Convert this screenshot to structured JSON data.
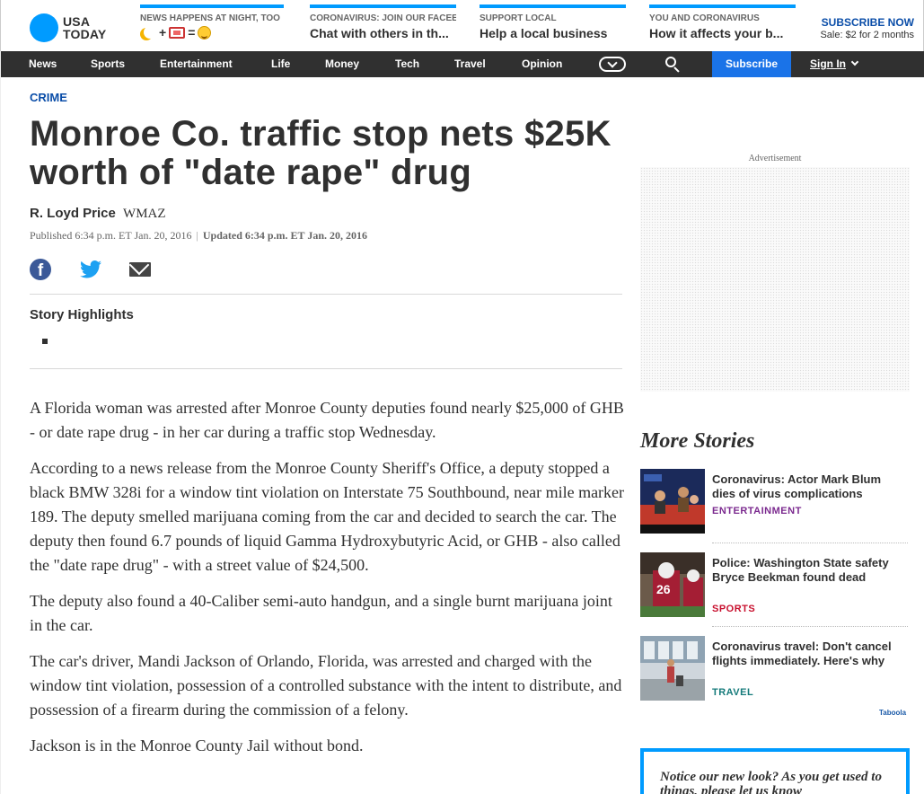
{
  "brand": {
    "line1": "USA",
    "line2": "TODAY"
  },
  "promos": [
    {
      "kicker": "NEWS HAPPENS AT NIGHT, TOO",
      "title": "= "
    },
    {
      "kicker": "CORONAVIRUS: JOIN OUR FACEE",
      "title": "Chat with others in th..."
    },
    {
      "kicker": "SUPPORT LOCAL",
      "title": "Help a local business"
    },
    {
      "kicker": "YOU AND CORONAVIRUS",
      "title": "How it affects your b..."
    }
  ],
  "subscribe_cta": {
    "title": "SUBSCRIBE NOW",
    "subtitle": "Sale: $2 for 2 months"
  },
  "nav": {
    "items": [
      "News",
      "Sports",
      "Entertainment",
      "Life",
      "Money",
      "Tech",
      "Travel",
      "Opinion"
    ],
    "subscribe": "Subscribe",
    "signin": "Sign In"
  },
  "article": {
    "section": "CRIME",
    "headline": "Monroe Co. traffic stop nets $25K worth of \"date rape\" drug",
    "author": "R. Loyd Price",
    "source": "WMAZ",
    "published": "Published 6:34 p.m. ET Jan. 20, 2016",
    "separator": "|",
    "updated": "Updated 6:34 p.m. ET Jan. 20, 2016",
    "highlights_title": "Story Highlights",
    "paragraphs": [
      "A Florida woman was arrested after Monroe County deputies found nearly $25,000 of GHB - or date rape drug - in her car during a traffic stop Wednesday.",
      "According to a news release from the Monroe County Sheriff's Office, a deputy stopped a black BMW 328i for a window tint violation on Interstate 75 Southbound, near mile marker 189. The deputy smelled marijuana coming from the car and decided to search the car. The deputy then found 6.7 pounds of liquid Gamma Hydroxybutyric Acid, or GHB - also called the \"date rape drug\" - with a street value of $24,500.",
      "The deputy also found a 40-Caliber semi-auto handgun, and a single burnt marijuana joint in the car.",
      "The car's driver, Mandi Jackson of Orlando, Florida, was arrested and charged with the window tint violation, possession of a controlled substance with the intent to distribute, and possession of a firearm during the commission of a felony.",
      "Jackson is in the Monroe County Jail without bond."
    ]
  },
  "sidebar": {
    "ad_label": "Advertisement",
    "more_stories_title": "More Stories",
    "stories": [
      {
        "title": "Coronavirus: Actor Mark Blum dies of virus complications",
        "category": "ENTERTAINMENT",
        "color": "#7b2a8f"
      },
      {
        "title": "Police: Washington State safety Bryce Beekman found dead",
        "category": "SPORTS",
        "color": "#c8102e"
      },
      {
        "title": "Coronavirus travel: Don't cancel flights immediately. Here's why",
        "category": "TRAVEL",
        "color": "#147a7a"
      }
    ],
    "taboola": "Taboola",
    "notice": {
      "text": "Notice our new look? As you get used to things, please",
      "link": "let us know"
    }
  },
  "colors": {
    "brand_blue": "#009bff",
    "nav_bg": "#303030",
    "subscribe_btn": "#1a73e8",
    "link_blue": "#0a4da8"
  },
  "icons": [
    "facebook-icon",
    "twitter-icon",
    "mail-icon",
    "search-icon",
    "chevron-down-icon"
  ]
}
